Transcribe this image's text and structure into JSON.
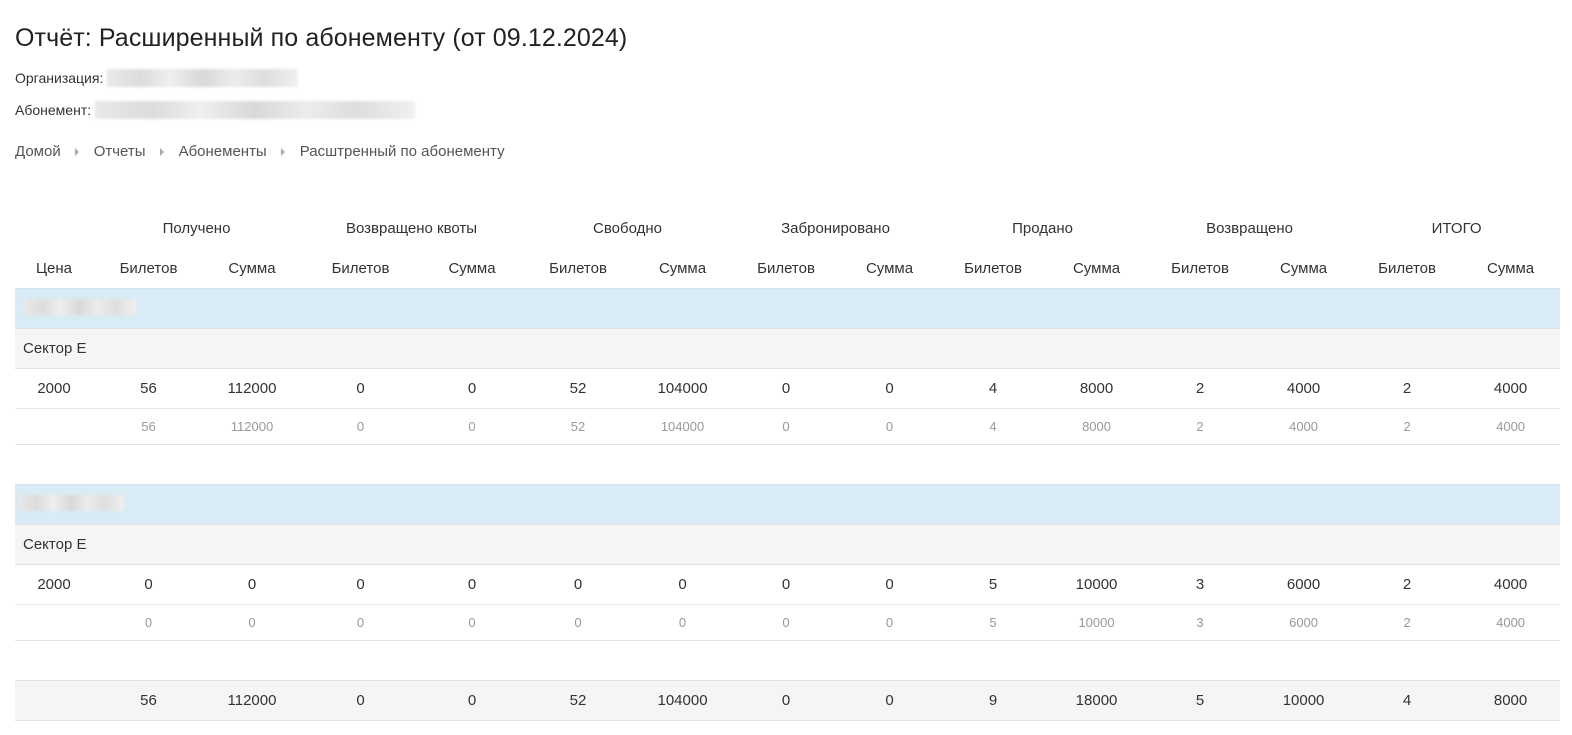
{
  "header": {
    "title": "Отчёт: Расширенный по абонементу (от 09.12.2024)",
    "organization_label": "Организация:",
    "subscription_label": "Абонемент:"
  },
  "breadcrumb": [
    "Домой",
    "Отчеты",
    "Абонементы",
    "Расштренный по абонементу"
  ],
  "table": {
    "group_headers": [
      "Получено",
      "Возвращено квоты",
      "Свободно",
      "Забронировано",
      "Продано",
      "Возвращено",
      "ИТОГО"
    ],
    "columns": [
      "Цена",
      "Билетов",
      "Сумма",
      "Билетов",
      "Сумма",
      "Билетов",
      "Сумма",
      "Билетов",
      "Сумма",
      "Билетов",
      "Сумма",
      "Билетов",
      "Сумма",
      "Билетов",
      "Сумма"
    ],
    "sections": [
      {
        "sector": "Сектор Е",
        "row": [
          "2000",
          "56",
          "112000",
          "0",
          "0",
          "52",
          "104000",
          "0",
          "0",
          "4",
          "8000",
          "2",
          "4000",
          "2",
          "4000"
        ],
        "subtotal": [
          "",
          "56",
          "112000",
          "0",
          "0",
          "52",
          "104000",
          "0",
          "0",
          "4",
          "8000",
          "2",
          "4000",
          "2",
          "4000"
        ]
      },
      {
        "sector": "Сектор Е",
        "row": [
          "2000",
          "0",
          "0",
          "0",
          "0",
          "0",
          "0",
          "0",
          "0",
          "5",
          "10000",
          "3",
          "6000",
          "2",
          "4000"
        ],
        "subtotal": [
          "",
          "0",
          "0",
          "0",
          "0",
          "0",
          "0",
          "0",
          "0",
          "5",
          "10000",
          "3",
          "6000",
          "2",
          "4000"
        ]
      }
    ],
    "total": [
      "",
      "56",
      "112000",
      "0",
      "0",
      "52",
      "104000",
      "0",
      "0",
      "9",
      "18000",
      "5",
      "10000",
      "4",
      "8000"
    ]
  }
}
